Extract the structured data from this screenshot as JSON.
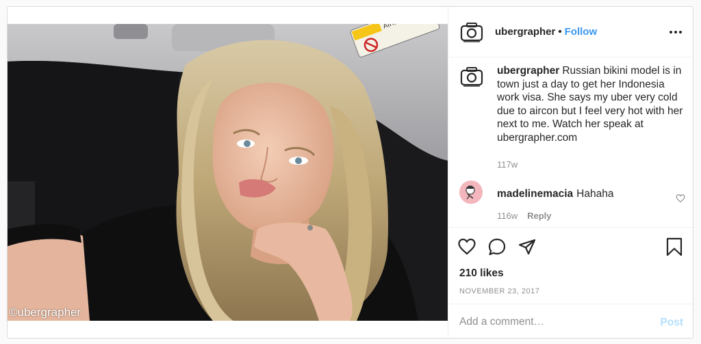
{
  "photo": {
    "watermark": "©ubergrapher",
    "sticker_text": "AIRBAG"
  },
  "header": {
    "username": "ubergrapher",
    "separator": "•",
    "follow_label": "Follow",
    "avatar_icon": "camera-icon",
    "more_icon": "more-options-icon"
  },
  "caption": {
    "username": "ubergrapher",
    "text": "Russian bikini model is in town just a day to get her Indonesia work visa. She says my uber very cold due to aircon but I feel very hot with her next to me. Watch her speak at ubergrapher.com",
    "time": "117w"
  },
  "comments": [
    {
      "username": "madelinemacia",
      "text": "Hahaha",
      "time": "116w",
      "reply_label": "Reply"
    }
  ],
  "actions": {
    "likes": "210 likes",
    "date": "NOVEMBER 23, 2017"
  },
  "add_comment": {
    "placeholder": "Add a comment…",
    "post_label": "Post"
  },
  "colors": {
    "link_blue": "#3897f0",
    "post_disabled": "#b2dffc",
    "secondary_text": "#8e8e8e",
    "border": "#dbdbdb"
  }
}
